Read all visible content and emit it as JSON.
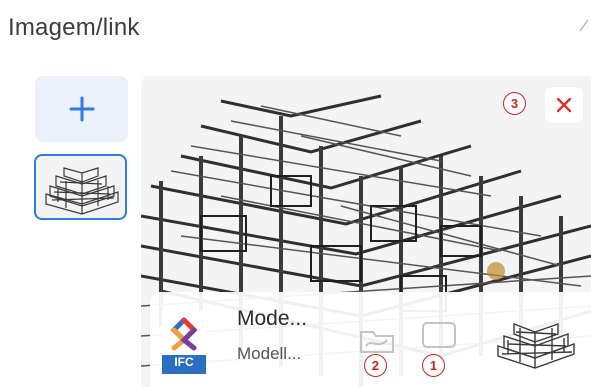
{
  "section": {
    "title": "Imagem/link"
  },
  "file": {
    "name": "Mode...",
    "subtitle": "Modell...",
    "type_badge": "IFC"
  },
  "markers": {
    "one": "1",
    "two": "2",
    "three": "3"
  },
  "icons": {
    "add": "plus-icon",
    "close": "close-icon",
    "folder": "folder-icon",
    "window": "window-icon",
    "file_type": "ifc-file-icon"
  },
  "colors": {
    "accent_blue": "#2f7de1",
    "add_button_bg": "#eaf1fb",
    "close_red": "#d9342b",
    "marker_red": "#c9271e"
  }
}
